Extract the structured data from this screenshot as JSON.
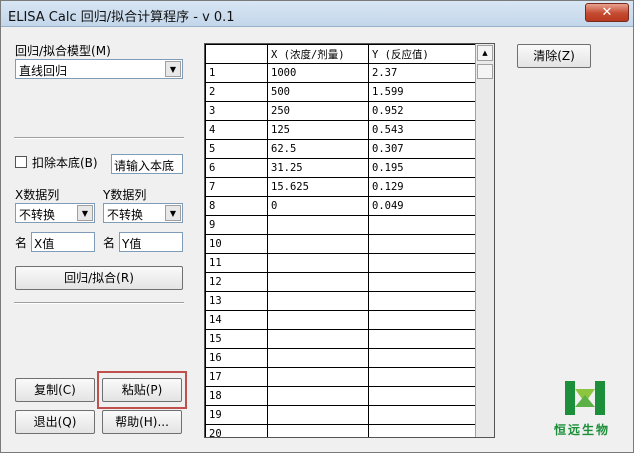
{
  "window": {
    "title": "ELISA Calc 回归/拟合计算程序 - v 0.1",
    "close_label": "✕"
  },
  "model": {
    "label": "回归/拟合模型(M)",
    "selected": "直线回归"
  },
  "baseline": {
    "checkbox_label": "扣除本底(B)",
    "input_value": "请输入本底"
  },
  "xcol": {
    "label": "X数据列",
    "selected": "不转换",
    "name_label": "名",
    "name_value": "X值"
  },
  "ycol": {
    "label": "Y数据列",
    "selected": "不转换",
    "name_label": "名",
    "name_value": "Y值"
  },
  "buttons": {
    "fit": "回归/拟合(R)",
    "copy": "复制(C)",
    "paste": "粘贴(P)",
    "exit": "退出(Q)",
    "help": "帮助(H)...",
    "clear": "清除(Z)"
  },
  "grid": {
    "headers": [
      "",
      "X (浓度/剂量)",
      "Y (反应值)"
    ],
    "rows": [
      [
        "1",
        "1000",
        "2.37"
      ],
      [
        "2",
        "500",
        "1.599"
      ],
      [
        "3",
        "250",
        "0.952"
      ],
      [
        "4",
        "125",
        "0.543"
      ],
      [
        "5",
        "62.5",
        "0.307"
      ],
      [
        "6",
        "31.25",
        "0.195"
      ],
      [
        "7",
        "15.625",
        "0.129"
      ],
      [
        "8",
        "0",
        "0.049"
      ],
      [
        "9",
        "",
        ""
      ],
      [
        "10",
        "",
        ""
      ],
      [
        "11",
        "",
        ""
      ],
      [
        "12",
        "",
        ""
      ],
      [
        "13",
        "",
        ""
      ],
      [
        "14",
        "",
        ""
      ],
      [
        "15",
        "",
        ""
      ],
      [
        "16",
        "",
        ""
      ],
      [
        "17",
        "",
        ""
      ],
      [
        "18",
        "",
        ""
      ],
      [
        "19",
        "",
        ""
      ],
      [
        "20",
        "",
        ""
      ]
    ]
  },
  "logo": {
    "text": "恒远生物",
    "color": "#1d8f3a"
  }
}
